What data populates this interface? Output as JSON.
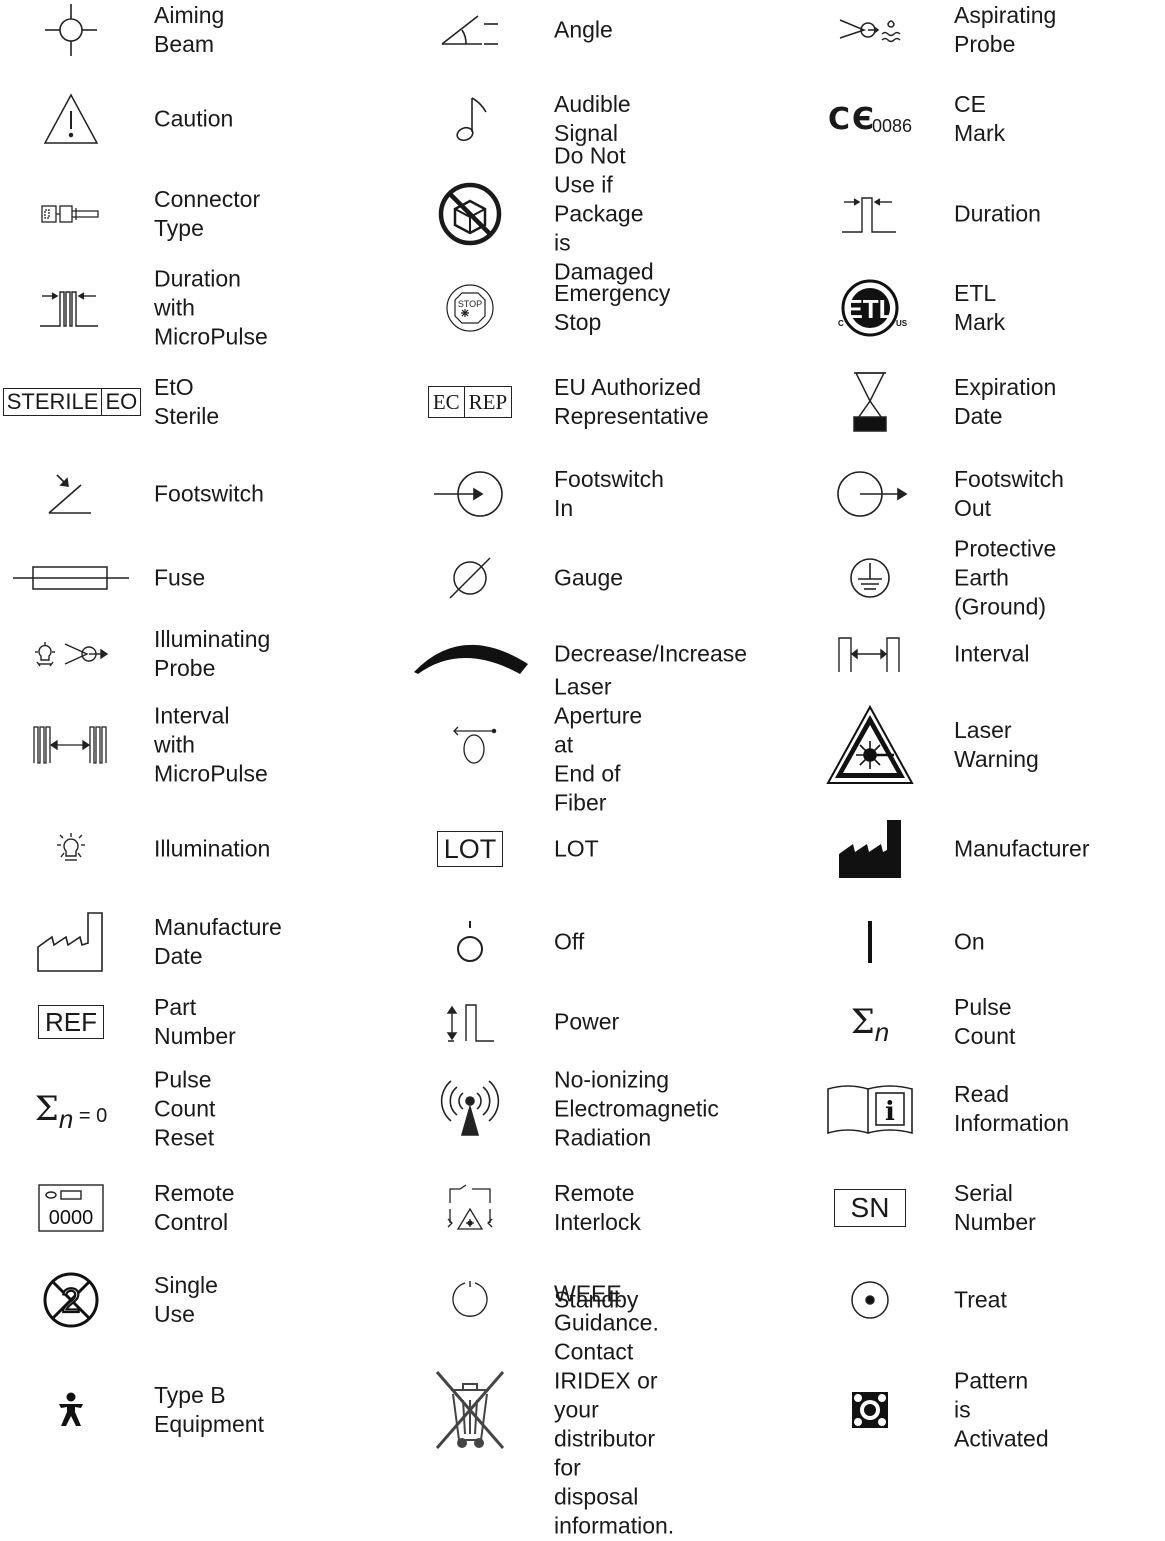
{
  "rows": [
    {
      "c1": {
        "label": "Aiming Beam",
        "icon": "aiming-beam-icon"
      },
      "c2": {
        "label": "Angle",
        "icon": "angle-icon"
      },
      "c3": {
        "label": "Aspirating Probe",
        "icon": "aspirating-probe-icon"
      }
    },
    {
      "c1": {
        "label": "Caution",
        "icon": "caution-icon"
      },
      "c2": {
        "label": "Audible Signal",
        "icon": "audible-signal-icon"
      },
      "c3": {
        "label": "CE Mark",
        "icon": "ce-mark-icon",
        "icon_text": "0086"
      }
    },
    {
      "c1": {
        "label": "Connector Type",
        "icon": "connector-type-icon"
      },
      "c2": {
        "label": "Do Not Use if\nPackage is Damaged",
        "icon": "do-not-use-if-damaged-icon"
      },
      "c3": {
        "label": "Duration",
        "icon": "duration-icon"
      }
    },
    {
      "c1": {
        "label": "Duration with\nMicroPulse",
        "icon": "duration-micropulse-icon"
      },
      "c2": {
        "label": "Emergency Stop",
        "icon": "emergency-stop-icon",
        "icon_text": "STOP"
      },
      "c3": {
        "label": "ETL Mark",
        "icon": "etl-mark-icon"
      }
    },
    {
      "c1": {
        "label": "EtO Sterile",
        "icon": "eto-sterile-icon",
        "icon_text": [
          "STERILE",
          "EO"
        ]
      },
      "c2": {
        "label": "EU Authorized\nRepresentative",
        "icon": "ec-rep-icon",
        "icon_text": [
          "EC",
          "REP"
        ]
      },
      "c3": {
        "label": "Expiration Date",
        "icon": "hourglass-icon"
      }
    },
    {
      "c1": {
        "label": "Footswitch",
        "icon": "footswitch-icon"
      },
      "c2": {
        "label": "Footswitch In",
        "icon": "footswitch-in-icon"
      },
      "c3": {
        "label": "Footswitch Out",
        "icon": "footswitch-out-icon"
      }
    },
    {
      "c1": {
        "label": "Fuse",
        "icon": "fuse-icon"
      },
      "c2": {
        "label": "Gauge",
        "icon": "gauge-icon"
      },
      "c3": {
        "label": "Protective Earth\n(Ground)",
        "icon": "protective-earth-icon"
      }
    },
    {
      "c1": {
        "label": "Illuminating Probe",
        "icon": "illuminating-probe-icon"
      },
      "c2": {
        "label": "Decrease/Increase",
        "icon": "decrease-increase-icon"
      },
      "c3": {
        "label": "Interval",
        "icon": "interval-icon"
      }
    },
    {
      "c1": {
        "label": "Interval with\nMicroPulse",
        "icon": "interval-micropulse-icon"
      },
      "c2": {
        "label": "Laser Aperture at\nEnd of Fiber",
        "icon": "laser-aperture-icon"
      },
      "c3": {
        "label": "Laser Warning",
        "icon": "laser-warning-icon"
      }
    },
    {
      "c1": {
        "label": "Illumination",
        "icon": "illumination-icon"
      },
      "c2": {
        "label": "LOT",
        "icon": "lot-icon",
        "icon_text": "LOT"
      },
      "c3": {
        "label": "Manufacturer",
        "icon": "manufacturer-icon"
      }
    },
    {
      "c1": {
        "label": "Manufacture Date",
        "icon": "manufacture-date-icon"
      },
      "c2": {
        "label": "Off",
        "icon": "off-icon"
      },
      "c3": {
        "label": "On",
        "icon": "on-icon"
      }
    },
    {
      "c1": {
        "label": "Part Number",
        "icon": "ref-icon",
        "icon_text": "REF"
      },
      "c2": {
        "label": "Power",
        "icon": "power-icon"
      },
      "c3": {
        "label": "Pulse Count",
        "icon": "pulse-count-icon",
        "icon_text": [
          "Σ",
          "n"
        ]
      }
    },
    {
      "c1": {
        "label": "Pulse Count Reset",
        "icon": "pulse-count-reset-icon",
        "icon_text": [
          "Σ",
          "n",
          " = 0"
        ]
      },
      "c2": {
        "label": "No-ionizing\nElectromagnetic\nRadiation",
        "icon": "non-ionizing-radiation-icon"
      },
      "c3": {
        "label": "Read Information",
        "icon": "read-information-icon",
        "icon_text": "i"
      }
    },
    {
      "c1": {
        "label": "Remote Control",
        "icon": "remote-control-icon",
        "icon_text": "0000"
      },
      "c2": {
        "label": "Remote Interlock",
        "icon": "remote-interlock-icon"
      },
      "c3": {
        "label": "Serial Number",
        "icon": "sn-icon",
        "icon_text": "SN"
      }
    },
    {
      "c1": {
        "label": "Single Use",
        "icon": "single-use-icon",
        "icon_text": "2"
      },
      "c2": {
        "label": "Standby",
        "icon": "standby-icon"
      },
      "c3": {
        "label": "Treat",
        "icon": "treat-icon"
      }
    },
    {
      "c1": {
        "label": "Type B Equipment",
        "icon": "type-b-icon"
      },
      "c2": {
        "label": "WEEE Guidance.\nContact IRIDEX or\nyour distributor for\ndisposal information.",
        "icon": "weee-icon"
      },
      "c3": {
        "label": "Pattern is Activated",
        "icon": "pattern-activated-icon"
      }
    }
  ]
}
